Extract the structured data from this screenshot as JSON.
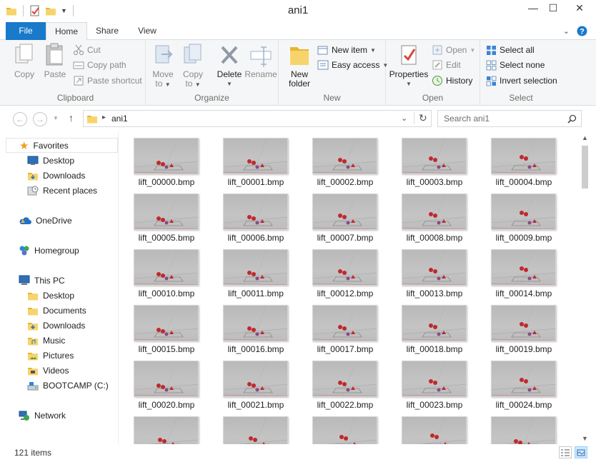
{
  "window": {
    "title": "ani1"
  },
  "ribbon_tabs": [
    {
      "label": "File"
    },
    {
      "label": "Home"
    },
    {
      "label": "Share"
    },
    {
      "label": "View"
    }
  ],
  "clipboard": {
    "label": "Clipboard",
    "copy": "Copy",
    "paste": "Paste",
    "cut": "Cut",
    "copy_path": "Copy path",
    "paste_shortcut": "Paste shortcut"
  },
  "organize": {
    "label": "Organize",
    "move_to_1": "Move",
    "move_to_2": "to",
    "copy_to_1": "Copy",
    "copy_to_2": "to",
    "delete": "Delete",
    "rename": "Rename"
  },
  "new": {
    "label": "New",
    "new_folder_1": "New",
    "new_folder_2": "folder",
    "new_item": "New item",
    "easy_access": "Easy access"
  },
  "open": {
    "label": "Open",
    "properties": "Properties",
    "open": "Open",
    "edit": "Edit",
    "history": "History"
  },
  "select": {
    "label": "Select",
    "select_all": "Select all",
    "select_none": "Select none",
    "invert_selection": "Invert selection"
  },
  "address": {
    "path": "ani1",
    "search_placeholder": "Search ani1"
  },
  "nav": {
    "favorites": "Favorites",
    "favorites_items": [
      "Desktop",
      "Downloads",
      "Recent places"
    ],
    "onedrive": "OneDrive",
    "homegroup": "Homegroup",
    "this_pc": "This PC",
    "this_pc_items": [
      "Desktop",
      "Documents",
      "Downloads",
      "Music",
      "Pictures",
      "Videos",
      "BOOTCAMP (C:)"
    ],
    "network": "Network"
  },
  "files": [
    "lift_00000.bmp",
    "lift_00001.bmp",
    "lift_00002.bmp",
    "lift_00003.bmp",
    "lift_00004.bmp",
    "lift_00005.bmp",
    "lift_00006.bmp",
    "lift_00007.bmp",
    "lift_00008.bmp",
    "lift_00009.bmp",
    "lift_00010.bmp",
    "lift_00011.bmp",
    "lift_00012.bmp",
    "lift_00013.bmp",
    "lift_00014.bmp",
    "lift_00015.bmp",
    "lift_00016.bmp",
    "lift_00017.bmp",
    "lift_00018.bmp",
    "lift_00019.bmp",
    "lift_00020.bmp",
    "lift_00021.bmp",
    "lift_00022.bmp",
    "lift_00023.bmp",
    "lift_00024.bmp"
  ],
  "partial_row_count": 5,
  "status": {
    "item_count": "121 items"
  },
  "colors": {
    "accent": "#1979ca",
    "ribbon_bg": "#f5f6f7",
    "thumb_marker": "#c0282d"
  }
}
